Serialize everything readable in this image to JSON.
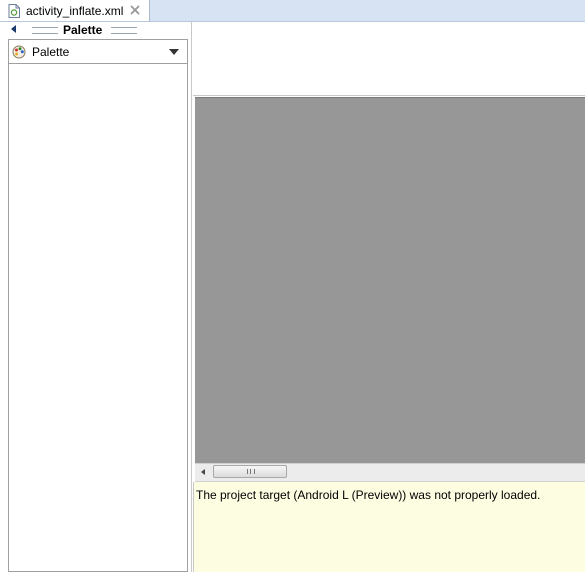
{
  "editor": {
    "tab": {
      "label": "activity_inflate.xml",
      "icon": "xml-file-icon",
      "close_icon": "close-icon"
    }
  },
  "palette": {
    "title": "Palette",
    "collapse_icon": "collapse-left-icon",
    "dropdown": {
      "label": "Palette",
      "icon": "palette-icon",
      "caret_icon": "chevron-down-icon"
    }
  },
  "canvas": {
    "background": "#979797",
    "scrollbar": {
      "left_icon": "scroll-left-icon",
      "position": 0.0
    }
  },
  "error_panel": {
    "message": "The project target (Android L (Preview)) was not properly loaded.",
    "background": "#fdfde2"
  }
}
